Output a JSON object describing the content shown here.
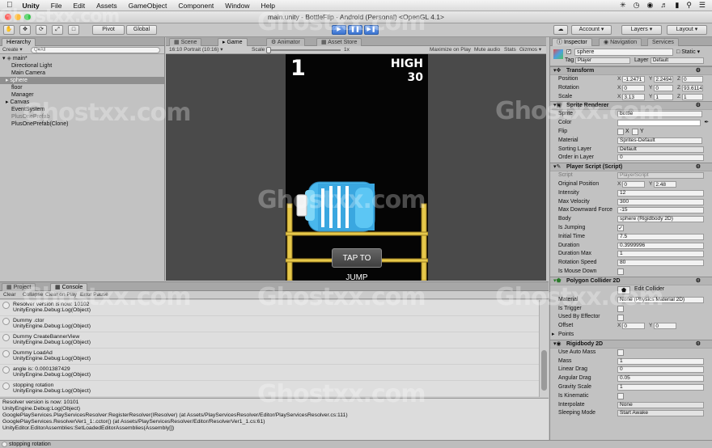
{
  "menubar": {
    "app": "Unity",
    "items": [
      "File",
      "Edit",
      "Assets",
      "GameObject",
      "Component",
      "Window",
      "Help"
    ]
  },
  "window": {
    "title": "main.unity - BottleFlip - Android (Personal) <OpenGL 4.1>"
  },
  "toolbar": {
    "pivot": "Pivot",
    "global": "Global",
    "account": "Account",
    "layers": "Layers",
    "layout": "Layout"
  },
  "hierarchy": {
    "tab": "Hierarchy",
    "create": "Create",
    "search_placeholder": "Q▾All",
    "scene": "main*",
    "items": [
      "Directional Light",
      "Main Camera",
      "sphere",
      "floor",
      "Manager",
      "Canvas",
      "EventSystem",
      "PlusOnePrefab",
      "PlusOnePrefab(Clone)"
    ]
  },
  "center_tabs": {
    "scene": "Scene",
    "game": "Game",
    "animator": "Animator",
    "asset_store": "Asset Store"
  },
  "game_bar": {
    "aspect": "16:10 Portrait (10:16)",
    "scale_label": "Scale",
    "scale_value": "1x",
    "maximize": "Maximize on Play",
    "mute": "Mute audio",
    "stats": "Stats",
    "gizmos": "Gizmos"
  },
  "game": {
    "score": "1",
    "high_label": "HIGH",
    "high_value": "30",
    "tap_label": "TAP TO JUMP"
  },
  "console": {
    "tab_project": "Project",
    "tab_console": "Console",
    "clear": "Clear",
    "collapse": "Collapse",
    "clear_on_play": "Clear on Play",
    "error_pause": "Error Pause",
    "entries": [
      {
        "msg": "Resolver version is now: 10102",
        "src": "UnityEngine.Debug:Log(Object)"
      },
      {
        "msg": "Dummy .ctor",
        "src": "UnityEngine.Debug:Log(Object)"
      },
      {
        "msg": "Dummy CreateBannerView",
        "src": "UnityEngine.Debug:Log(Object)"
      },
      {
        "msg": "Dummy LoadAd",
        "src": "UnityEngine.Debug:Log(Object)"
      },
      {
        "msg": "angle is: 0.0001387429",
        "src": "UnityEngine.Debug:Log(Object)"
      },
      {
        "msg": "stopping rotation",
        "src": "UnityEngine.Debug:Log(Object)"
      }
    ],
    "detail": [
      "Resolver version is now: 10101",
      "UnityEngine.Debug:Log(Object)",
      "GooglePlayServices.PlayServicesResolver:RegisterResolver(IResolver) (at Assets/PlayServicesResolver/Editor/PlayServicesResolver.cs:111)",
      "GooglePlayServices.ResolverVer1_1:.cctor() (at Assets/PlayServicesResolver/Editor/ResolverVer1_1.cs:61)",
      "UnityEditor.EditorAssemblies:SetLoadedEditorAssemblies(Assembly[])"
    ]
  },
  "status": {
    "text": "stopping rotation"
  },
  "inspector": {
    "tab_inspector": "Inspector",
    "tab_navigation": "Navigation",
    "tab_services": "Services",
    "object_name": "sphere",
    "static_label": "Static",
    "tag_label": "Tag",
    "tag_value": "Player",
    "layer_label": "Layer",
    "layer_value": "Default",
    "transform": {
      "title": "Transform",
      "position": [
        "-1.2471",
        "2.2494",
        "0"
      ],
      "rotation": [
        "0",
        "0",
        "93.6114"
      ],
      "scale": [
        "3.13",
        "1",
        "1"
      ],
      "labels": [
        "Position",
        "Rotation",
        "Scale"
      ]
    },
    "sprite_renderer": {
      "title": "Sprite Renderer",
      "rows": [
        [
          "Sprite",
          "bottle"
        ],
        [
          "Color",
          ""
        ],
        [
          "Flip",
          ""
        ],
        [
          "Material",
          "Sprites-Default"
        ],
        [
          "Sorting Layer",
          "Default"
        ],
        [
          "Order in Layer",
          "0"
        ]
      ]
    },
    "player_script": {
      "title": "Player Script (Script)",
      "rows": [
        [
          "Script",
          "PlayerScript"
        ],
        [
          "Original Position",
          ""
        ],
        [
          "Intensity",
          "12"
        ],
        [
          "Max Velocity",
          "300"
        ],
        [
          "Max Downward Force",
          "-15"
        ],
        [
          "Body",
          "sphere (Rigidbody 2D)"
        ],
        [
          "Is Jumping",
          ""
        ],
        [
          "Initial Time",
          "7.5"
        ],
        [
          "Duration",
          "0.3999996"
        ],
        [
          "Duration Max",
          "1"
        ],
        [
          "Rotation Speed",
          "80"
        ],
        [
          "Is Mouse Down",
          ""
        ]
      ],
      "orig_x": "0",
      "orig_y": "2.48"
    },
    "polygon": {
      "title": "Polygon Collider 2D",
      "edit": "Edit Collider",
      "rows": [
        [
          "Material",
          "None (Physics Material 2D)"
        ],
        [
          "Is Trigger",
          ""
        ],
        [
          "Used By Effector",
          ""
        ],
        [
          "Offset",
          ""
        ],
        [
          "Points",
          ""
        ]
      ],
      "off_x": "0",
      "off_y": "0"
    },
    "rigidbody": {
      "title": "Rigidbody 2D",
      "rows": [
        [
          "Use Auto Mass",
          ""
        ],
        [
          "Mass",
          "1"
        ],
        [
          "Linear Drag",
          "0"
        ],
        [
          "Angular Drag",
          "0.05"
        ],
        [
          "Gravity Scale",
          "1"
        ],
        [
          "Is Kinematic",
          ""
        ],
        [
          "Interpolate",
          "None"
        ],
        [
          "Sleeping Mode",
          "Start Awake"
        ]
      ]
    }
  },
  "watermarks": [
    "Ghostxx.com",
    "Ghostxx.com",
    "Ghostxx.com",
    "Ghostxx.com",
    "Ghostxx.com",
    "Ghostxx.com",
    "Ghostxx.com",
    "Ghostxx.com",
    "Ghostxx.com"
  ]
}
